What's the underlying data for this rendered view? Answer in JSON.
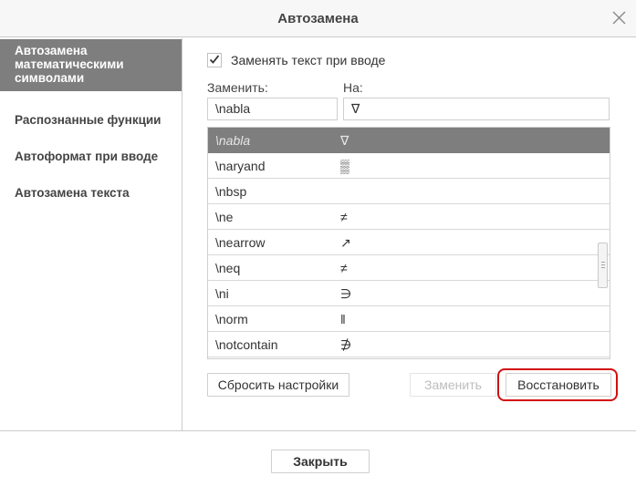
{
  "dialog": {
    "title": "Автозамена",
    "close_icon": "close-icon"
  },
  "sidebar": {
    "items": [
      {
        "label": "Автозамена математическими символами",
        "lines": [
          "Автозамена",
          "математическими",
          "символами"
        ],
        "active": true
      },
      {
        "label": "Распознанные функции",
        "active": false
      },
      {
        "label": "Автоформат при вводе",
        "active": false
      },
      {
        "label": "Автозамена текста",
        "active": false
      }
    ]
  },
  "main": {
    "replace_on_type": {
      "label": "Заменять текст при вводе",
      "checked": true
    },
    "replace_label": "Заменить:",
    "with_label": "На:",
    "replace_value": "\\nabla",
    "with_value": "∇",
    "table": {
      "rows": [
        {
          "key": "\\nabla",
          "symbol": "∇",
          "selected": true
        },
        {
          "key": "\\naryand",
          "symbol": "▒",
          "selected": false
        },
        {
          "key": "\\nbsp",
          "symbol": "",
          "selected": false
        },
        {
          "key": "\\ne",
          "symbol": "≠",
          "selected": false
        },
        {
          "key": "\\nearrow",
          "symbol": "↗",
          "selected": false
        },
        {
          "key": "\\neq",
          "symbol": "≠",
          "selected": false
        },
        {
          "key": "\\ni",
          "symbol": "∋",
          "selected": false
        },
        {
          "key": "\\norm",
          "symbol": "‖",
          "selected": false
        },
        {
          "key": "\\notcontain",
          "symbol": "∌",
          "selected": false
        }
      ]
    },
    "buttons": {
      "reset": "Сбросить настройки",
      "replace": "Заменить",
      "restore": "Восстановить"
    }
  },
  "footer": {
    "close": "Закрыть"
  },
  "colors": {
    "selected_row_bg": "#7e7e7e",
    "sidebar_active_bg": "#7e7e7e",
    "highlight_outline": "#d20f0f"
  }
}
